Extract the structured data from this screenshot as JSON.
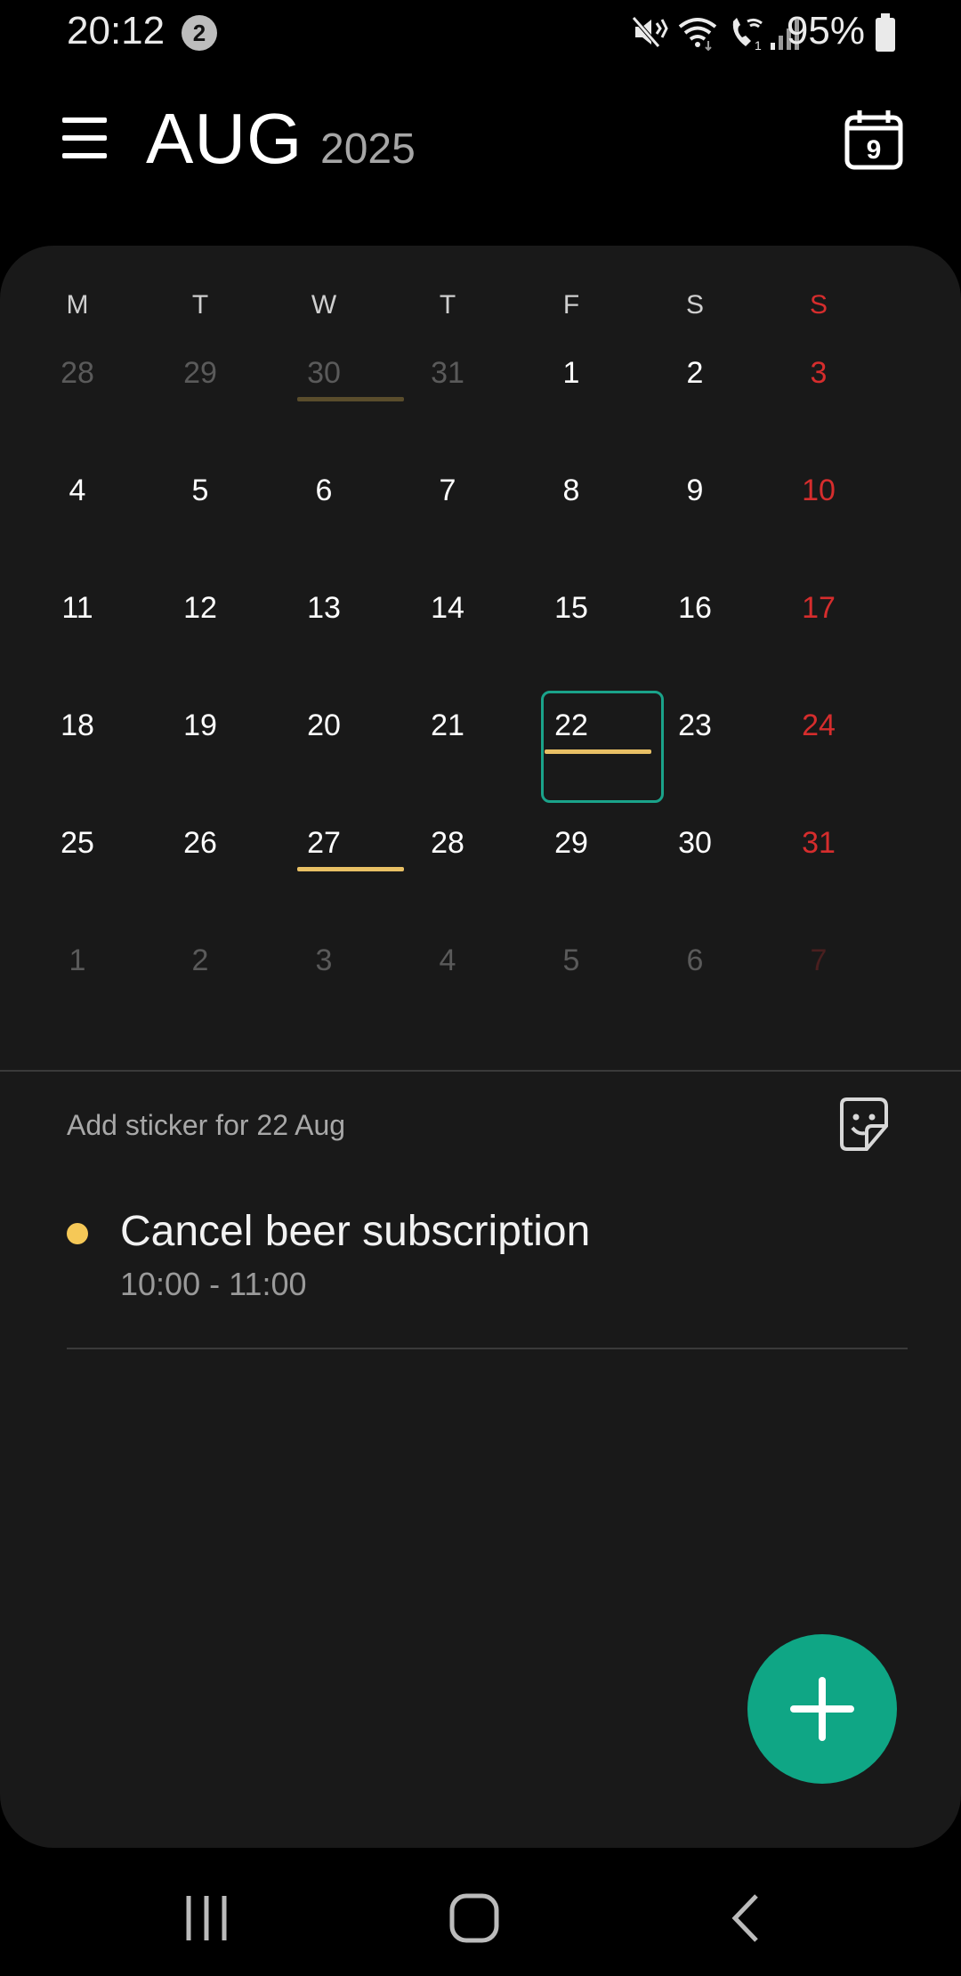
{
  "status_bar": {
    "time": "20:12",
    "notification_count": "2",
    "battery": "95%",
    "icons": [
      "mute-icon",
      "wifi-icon",
      "wifi-calling-icon",
      "signal-icon",
      "battery-icon"
    ]
  },
  "header": {
    "month": "AUG",
    "year": "2025",
    "today_day": "9"
  },
  "calendar": {
    "weekdays": [
      "M",
      "T",
      "W",
      "T",
      "F",
      "S",
      "S"
    ],
    "weeks": [
      [
        "28",
        "29",
        "30",
        "31",
        "1",
        "2",
        "3"
      ],
      [
        "4",
        "5",
        "6",
        "7",
        "8",
        "9",
        "10"
      ],
      [
        "11",
        "12",
        "13",
        "14",
        "15",
        "16",
        "17"
      ],
      [
        "18",
        "19",
        "20",
        "21",
        "22",
        "23",
        "24"
      ],
      [
        "25",
        "26",
        "27",
        "28",
        "29",
        "30",
        "31"
      ],
      [
        "1",
        "2",
        "3",
        "4",
        "5",
        "6",
        "7"
      ]
    ],
    "selected_date": "22",
    "colors": {
      "weekday": "#ffffff",
      "sunday": "#d62d2d",
      "other_month": "#5a5a5a",
      "accent": "#0fa685",
      "event": "#e8c065",
      "event_past": "#5a4d2c"
    }
  },
  "sticker": {
    "label": "Add sticker for 22 Aug"
  },
  "events": [
    {
      "title": "Cancel beer subscription",
      "time": "10:00 - 11:00",
      "color": "#f5c857"
    }
  ],
  "navbar": {
    "icons": [
      "recents-icon",
      "home-icon",
      "back-icon"
    ]
  }
}
